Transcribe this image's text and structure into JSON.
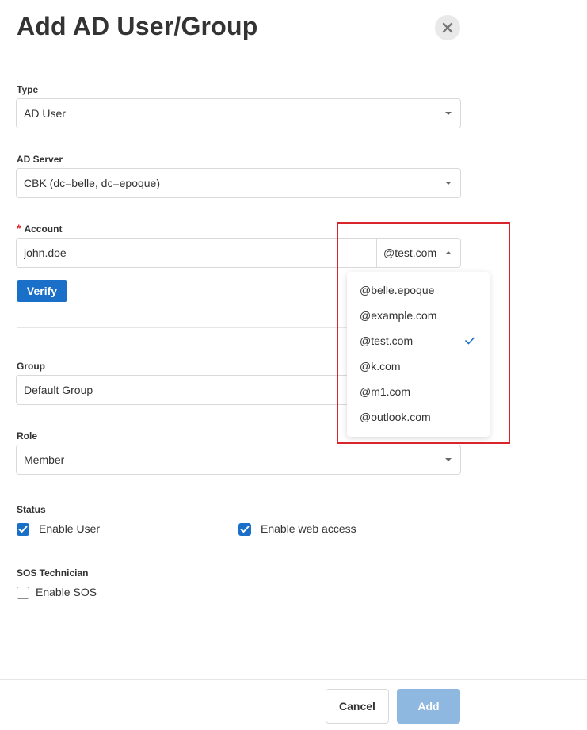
{
  "dialog": {
    "title": "Add AD User/Group"
  },
  "form": {
    "type": {
      "label": "Type",
      "value": "AD User"
    },
    "ad_server": {
      "label": "AD Server",
      "value": "CBK (dc=belle, dc=epoque)"
    },
    "account": {
      "required_mark": "*",
      "label": "Account",
      "value": "john.doe",
      "domain_value": "@test.com",
      "verify_label": "Verify"
    },
    "group": {
      "label": "Group",
      "value": "Default Group"
    },
    "role": {
      "label": "Role",
      "value": "Member"
    },
    "status": {
      "label": "Status",
      "enable_user": {
        "label": "Enable User",
        "checked": true
      },
      "enable_web_access": {
        "label": "Enable web access",
        "checked": true
      }
    },
    "sos": {
      "label": "SOS Technician",
      "enable_sos": {
        "label": "Enable SOS",
        "checked": false
      }
    }
  },
  "domain_dropdown": {
    "options": [
      "@belle.epoque",
      "@example.com",
      "@test.com",
      "@k.com",
      "@m1.com",
      "@outlook.com"
    ],
    "selected": "@test.com"
  },
  "footer": {
    "cancel_label": "Cancel",
    "add_label": "Add"
  },
  "colors": {
    "primary": "#1a6fc9",
    "primary_disabled": "#8fb8e0",
    "highlight": "#d9252a",
    "required": "#e02020"
  },
  "icons": {
    "close": "close-icon",
    "check": "checkmark-icon",
    "caret_down": "caret-down-icon",
    "caret_up": "caret-up-icon"
  }
}
